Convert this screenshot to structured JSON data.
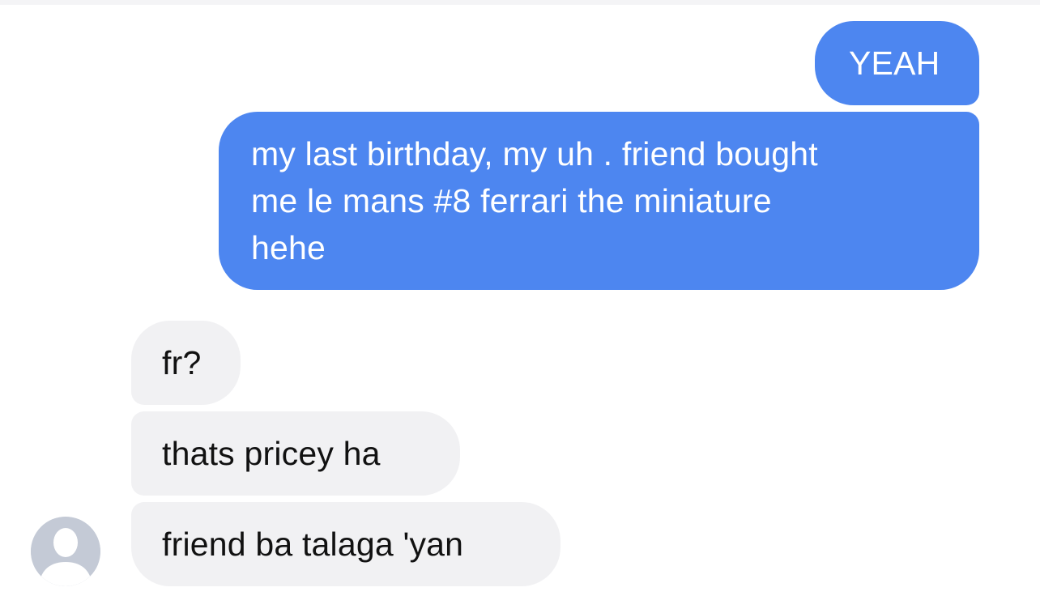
{
  "conversation": {
    "messages": [
      {
        "sender": "me",
        "text": "YEAH"
      },
      {
        "sender": "me",
        "text": "my last birthday, my uh . friend bought\nme le mans #8 ferrari the miniature\nhehe"
      },
      {
        "sender": "other",
        "text": "fr?"
      },
      {
        "sender": "other",
        "text": "thats pricey ha"
      },
      {
        "sender": "other",
        "text": "friend ba talaga 'yan"
      }
    ]
  },
  "avatar": {
    "icon": "default-profile-icon"
  },
  "colors": {
    "outgoing_bubble": "#4d86f0",
    "incoming_bubble": "#f1f1f3",
    "avatar_bg": "#c4cad6"
  }
}
